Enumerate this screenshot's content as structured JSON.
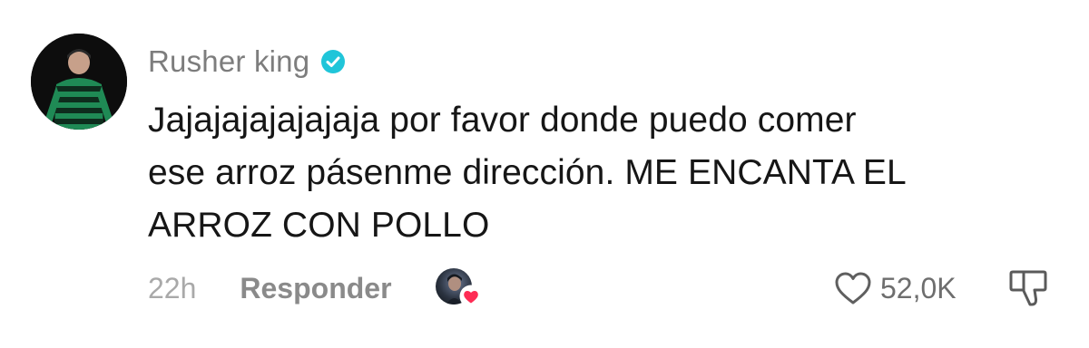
{
  "comment": {
    "username": "Rusher king",
    "verified_icon": "verified-badge-icon",
    "text": "Jajajajajajajaja por favor donde puedo comer\nese arroz pásenme dirección. ME ENCANTA EL\nARROZ CON POLLO",
    "time": "22h",
    "reply_label": "Responder",
    "like_count": "52,0K",
    "like_icon": "heart-outline-icon",
    "dislike_icon": "thumbs-down-icon",
    "creator_liked_icon": "creator-heart-icon"
  },
  "colors": {
    "verified": "#20c5d9",
    "creator_heart": "#fe2c55",
    "avatar_stripe": "#1f8a55"
  }
}
